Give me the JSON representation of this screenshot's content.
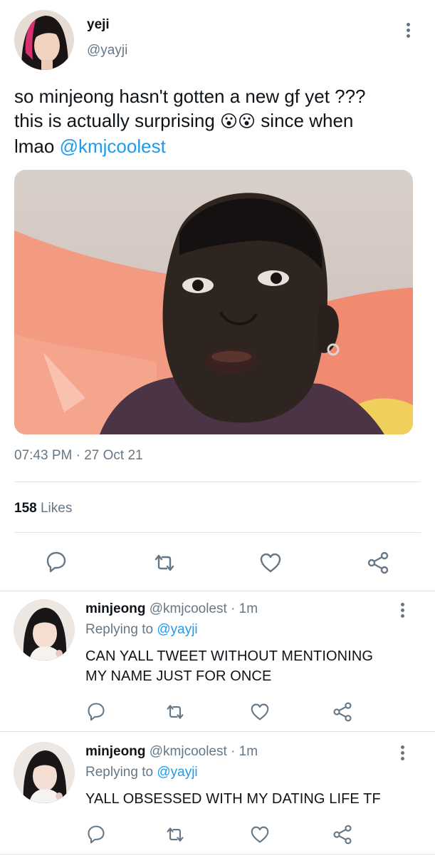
{
  "main_tweet": {
    "author_name": "yeji",
    "author_handle": "@yayji",
    "text_line1": "so minjeong hasn't gotten a new gf yet ???",
    "text_line2_a": "this is actually surprising",
    "emoji": "😮😮",
    "text_line2_b": "since when",
    "text_line3_a": "lmao",
    "text_mention": "@kmjcoolest",
    "timestamp": "07:43 PM",
    "date_sep": "·",
    "date": "27 Oct 21",
    "likes_count": "158",
    "likes_label": "Likes"
  },
  "replies": [
    {
      "name": "minjeong",
      "handle": "@kmjcoolest",
      "sep": "·",
      "time": "1m",
      "replying_label": "Replying to",
      "replying_to": "@yayji",
      "text_line1": "CAN YALL TWEET WITHOUT MENTIONING",
      "text_line2": "MY NAME JUST FOR ONCE"
    },
    {
      "name": "minjeong",
      "handle": "@kmjcoolest",
      "sep": "·",
      "time": "1m",
      "replying_label": "Replying to",
      "replying_to": "@yayji",
      "text_line1": "YALL OBSESSED WITH MY DATING LIFE TF"
    }
  ],
  "icons": {
    "reply": "reply-icon",
    "retweet": "retweet-icon",
    "like": "heart-icon",
    "share": "share-icon",
    "more": "more-vertical-icon"
  },
  "colors": {
    "link": "#1d9bf0",
    "muted": "#657786",
    "divider": "#dfe3e6"
  }
}
